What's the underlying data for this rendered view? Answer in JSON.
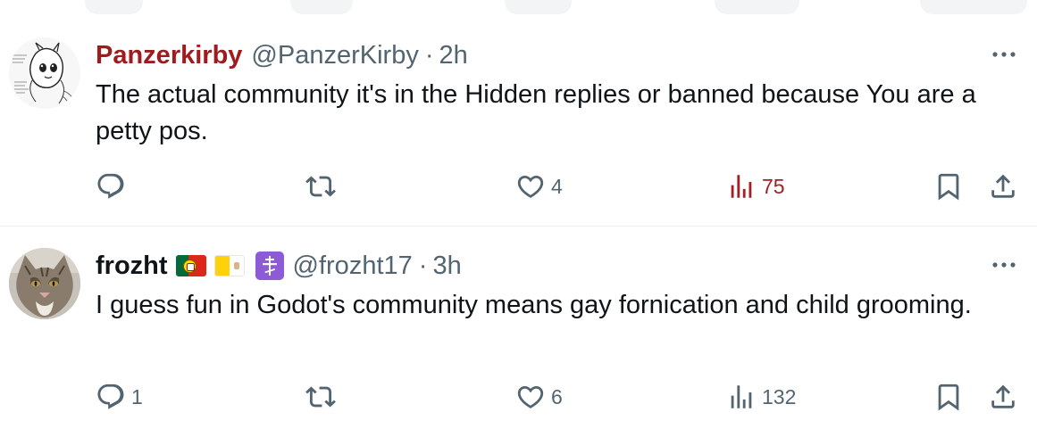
{
  "tweets": [
    {
      "display_name": "Panzerkirby",
      "display_name_color": "#9e1b1e",
      "handle": "@PanzerKirby",
      "separator": "·",
      "time": "2h",
      "text": "The actual community it's in the Hidden replies or banned because You are a petty pos.",
      "avatar_icon": "manga-sketch-avatar",
      "replies": "",
      "retweets": "",
      "likes": "4",
      "views": "75",
      "views_active": true
    },
    {
      "display_name": "frozht",
      "display_name_color": "#0f1419",
      "badges": [
        "portugal-flag-icon",
        "vatican-flag-icon",
        "orthodox-cross-icon"
      ],
      "handle": "@frozht17",
      "separator": "·",
      "time": "3h",
      "text": "I guess fun in Godot's community means gay fornication and child grooming.",
      "avatar_icon": "cat-photo-avatar",
      "replies": "1",
      "retweets": "",
      "likes": "6",
      "views": "132",
      "views_active": false
    }
  ],
  "colors": {
    "secondary_text": "#536471",
    "primary_text": "#0f1419",
    "views_active": "#a51e22",
    "divider": "#eff3f4",
    "badge_purple": "#8e5bd6"
  },
  "icons": [
    "reply-icon",
    "retweet-icon",
    "like-icon",
    "views-icon",
    "bookmark-icon",
    "share-icon",
    "more-icon"
  ]
}
